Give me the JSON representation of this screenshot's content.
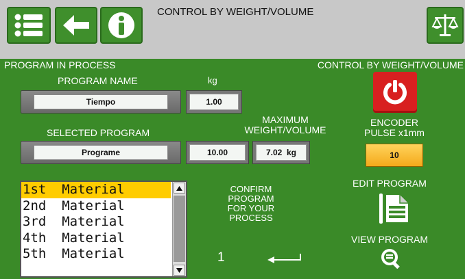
{
  "header": {
    "title": "CONTROL BY WEIGHT/VOLUME",
    "icons": [
      "list-icon",
      "back-arrow-icon",
      "info-icon",
      "scale-icon"
    ]
  },
  "main": {
    "program_in_process": "PROGRAM IN PROCESS",
    "mode_label": "CONTROL BY WEIGHT/VOLUME",
    "program_name_label": "PROGRAM NAME",
    "program_name_value": "Tiempo",
    "unit_label": "kg",
    "unit_value": "1.00",
    "selected_program_label": "SELECTED PROGRAM",
    "selected_program_value": "Programe",
    "selected_value": "10.00",
    "maximum_label_line1": "MAXIMUM",
    "maximum_label_line2": "WEIGHT/VOLUME",
    "maximum_value": "7.02  kg",
    "encoder_label_line1": "ENCODER",
    "encoder_label_line2": "PULSE x1mm",
    "encoder_value": "10",
    "confirm_line1": "CONFIRM",
    "confirm_line2": "PROGRAM",
    "confirm_line3": "FOR YOUR",
    "confirm_line4": "PROCESS",
    "confirm_number": "1",
    "edit_program_label": "EDIT PROGRAM",
    "view_program_label": "VIEW PROGRAM"
  },
  "materials": [
    {
      "label": "1st  Material"
    },
    {
      "label": "2nd  Material"
    },
    {
      "label": "3rd  Material"
    },
    {
      "label": "4th  Material"
    },
    {
      "label": "5th  Material"
    }
  ],
  "colors": {
    "panel_green": "#3a8a28",
    "header_gray": "#c8c8c8",
    "power_red": "#d82020",
    "encoder_orange": "#f4a91a",
    "selected_yellow": "#ffcc00"
  }
}
